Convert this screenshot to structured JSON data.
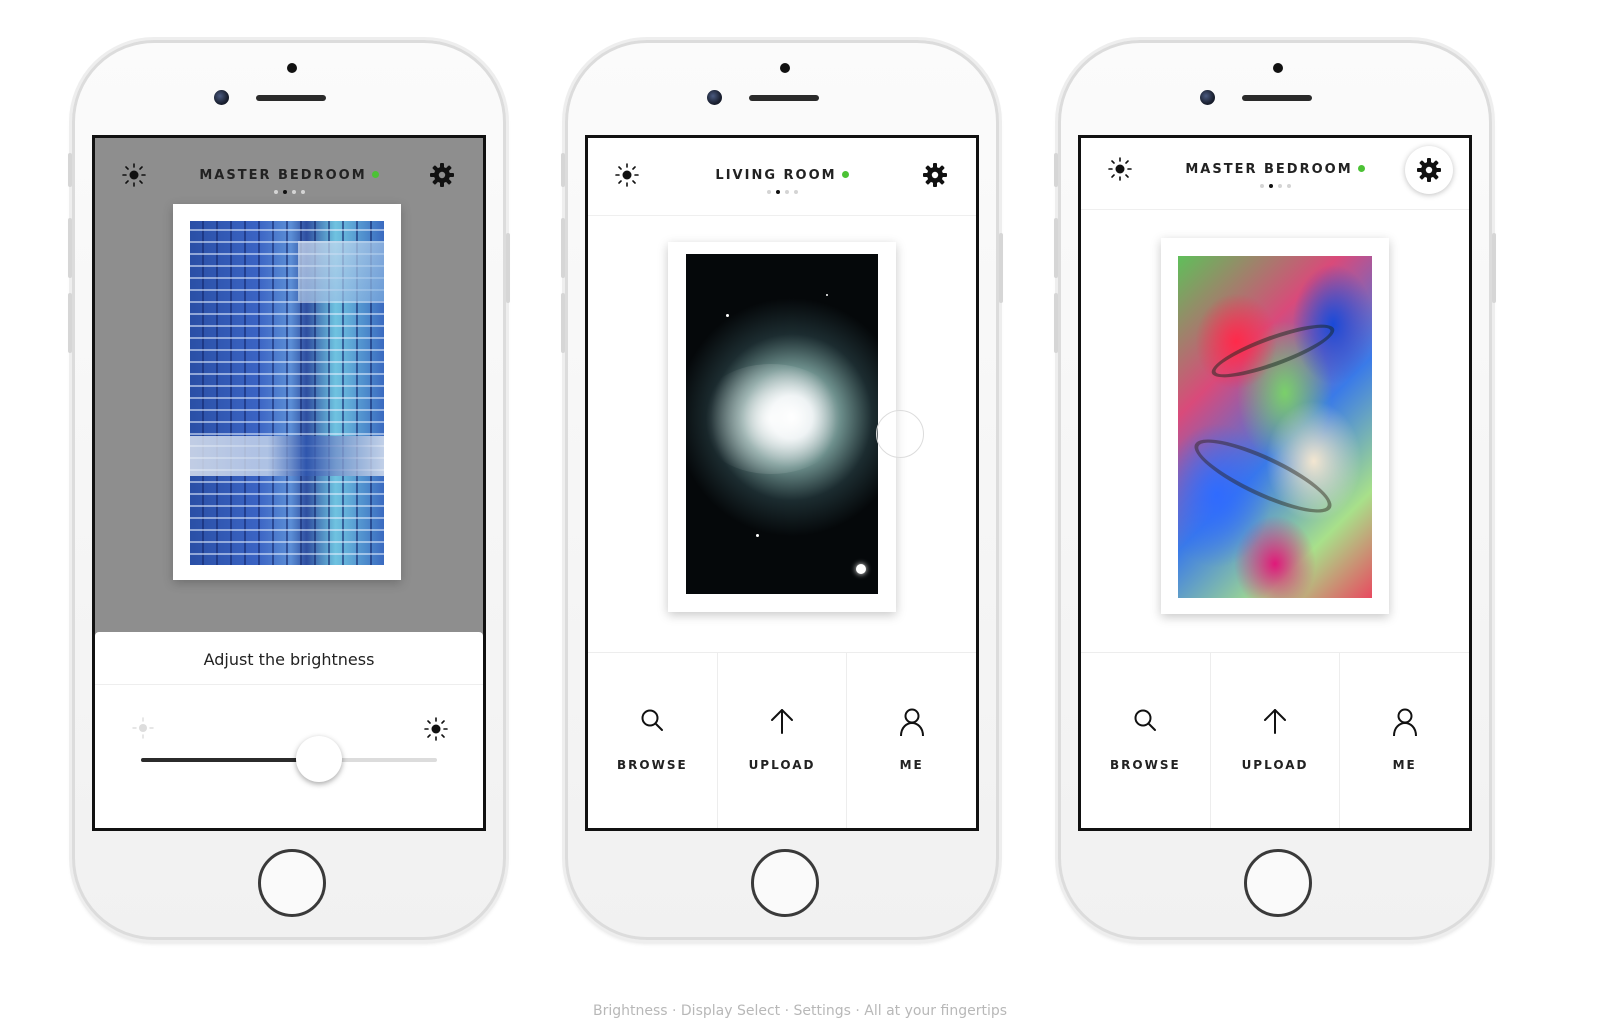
{
  "colors": {
    "live_dot": "#4cc235",
    "dim_overlay": "#8e8e8e",
    "frame": "#111111"
  },
  "phones": [
    {
      "room": "MASTER BEDROOM",
      "page_dots": 4,
      "active_dot": 1,
      "artwork": "blue-building-glitch",
      "overlay": {
        "title": "Adjust the brightness",
        "brightness_low_icon": "sun-dim-icon",
        "brightness_high_icon": "sun-icon",
        "brightness_level": 0.6
      }
    },
    {
      "room": "LIVING ROOM",
      "page_dots": 4,
      "active_dot": 1,
      "artwork": "space-particles",
      "nav": [
        {
          "label": "BROWSE",
          "icon": "search-icon"
        },
        {
          "label": "UPLOAD",
          "icon": "upload-arrow-icon"
        },
        {
          "label": "ME",
          "icon": "user-icon"
        }
      ]
    },
    {
      "room": "MASTER BEDROOM",
      "page_dots": 4,
      "active_dot": 1,
      "artwork": "liquid-colour-swirl",
      "nav": [
        {
          "label": "BROWSE",
          "icon": "search-icon"
        },
        {
          "label": "UPLOAD",
          "icon": "upload-arrow-icon"
        },
        {
          "label": "ME",
          "icon": "user-icon"
        }
      ]
    }
  ],
  "caption": "Brightness · Display Select · Settings · All at your fingertips"
}
